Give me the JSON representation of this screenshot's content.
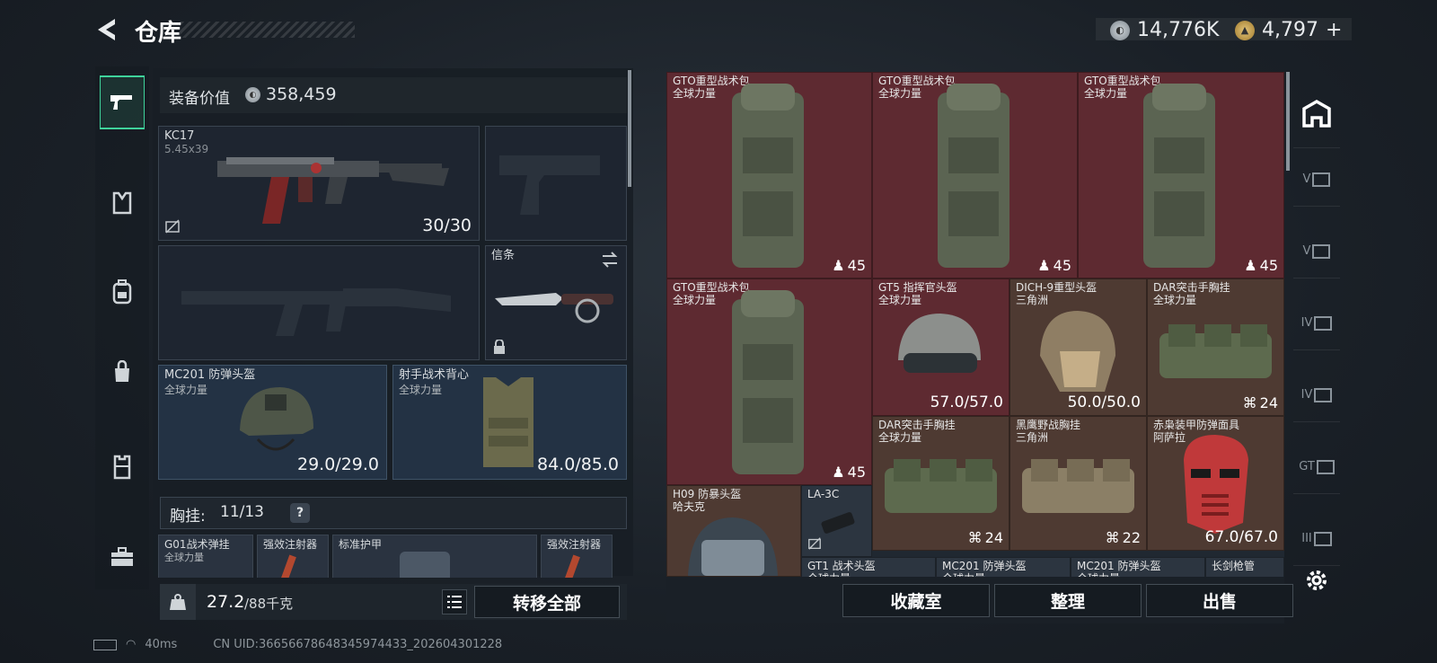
{
  "header": {
    "title": "仓库",
    "currency_1": "14,776K",
    "currency_2": "4,797",
    "plus": "+"
  },
  "left_tabs": [
    "pistol-icon",
    "chest-rig-icon",
    "backpack-icon",
    "bag-icon",
    "armor-icon",
    "case-icon"
  ],
  "equipment": {
    "value_label": "装备价值",
    "value": "358,459"
  },
  "weapon_primary": {
    "name": "KC17",
    "caliber": "5.45x39",
    "ammo": "30/30"
  },
  "melee": {
    "name": "信条"
  },
  "helmet": {
    "name": "MC201 防弹头盔",
    "faction": "全球力量",
    "durability": "29.0/29.0"
  },
  "vest": {
    "name": "射手战术背心",
    "faction": "全球力量",
    "durability": "84.0/85.0"
  },
  "chest_rig": {
    "label": "胸挂:",
    "count": "11/13",
    "help": "?"
  },
  "rig_items": [
    {
      "name": "G01战术弹挂",
      "sub": "全球力量"
    },
    {
      "name": "强效注射器"
    },
    {
      "name": "标准护甲"
    },
    {
      "name": "强效注射器"
    }
  ],
  "bottom_left": {
    "weight": "27.2",
    "weight_max": "/88千克",
    "transfer": "转移全部"
  },
  "grid": {
    "bags": [
      {
        "name": "GTO重型战术包",
        "sub": "全球力量",
        "count": "45"
      },
      {
        "name": "GTO重型战术包",
        "sub": "全球力量",
        "count": "45"
      },
      {
        "name": "GTO重型战术包",
        "sub": "全球力量",
        "count": "45"
      },
      {
        "name": "GTO重型战术包",
        "sub": "全球力量",
        "count": "45"
      }
    ],
    "gt5": {
      "name": "GT5 指挥官头盔",
      "sub": "全球力量",
      "val": "57.0/57.0"
    },
    "dich": {
      "name": "DICH-9重型头盔",
      "sub": "三角洲",
      "val": "50.0/50.0"
    },
    "dar1": {
      "name": "DAR突击手胸挂",
      "sub": "全球力量",
      "count": "24"
    },
    "dar2": {
      "name": "DAR突击手胸挂",
      "sub": "全球力量",
      "count": "24"
    },
    "heiying": {
      "name": "黑鹰野战胸挂",
      "sub": "三角洲",
      "count": "22"
    },
    "mask": {
      "name": "赤枭装甲防弹面具",
      "sub": "阿萨拉",
      "val": "67.0/67.0"
    },
    "h09": {
      "name": "H09 防暴头盔",
      "sub": "哈夫克"
    },
    "la3c": {
      "name": "LA-3C"
    },
    "gt1": {
      "name": "GT1 战术头盔",
      "sub": "全球力量"
    },
    "mc201a": {
      "name": "MC201 防弹头盔",
      "sub": "全球力量"
    },
    "mc201b": {
      "name": "MC201 防弹头盔",
      "sub": "全球力量"
    },
    "sword": {
      "name": "长剑枪管"
    }
  },
  "actions": {
    "collection": "收藏室",
    "organize": "整理",
    "sell": "出售"
  },
  "right_tabs": [
    "V",
    "V",
    "IV",
    "IV",
    "GT",
    "III"
  ],
  "status_bar": {
    "ping": "40ms",
    "uid": "CN UID:36656678648345974433_202604301228"
  },
  "colors": {
    "accent_green": "#3fd39b",
    "cell_red": "#5e2a31",
    "cell_brown": "#4e3a32",
    "slot_blue": "#233244"
  }
}
